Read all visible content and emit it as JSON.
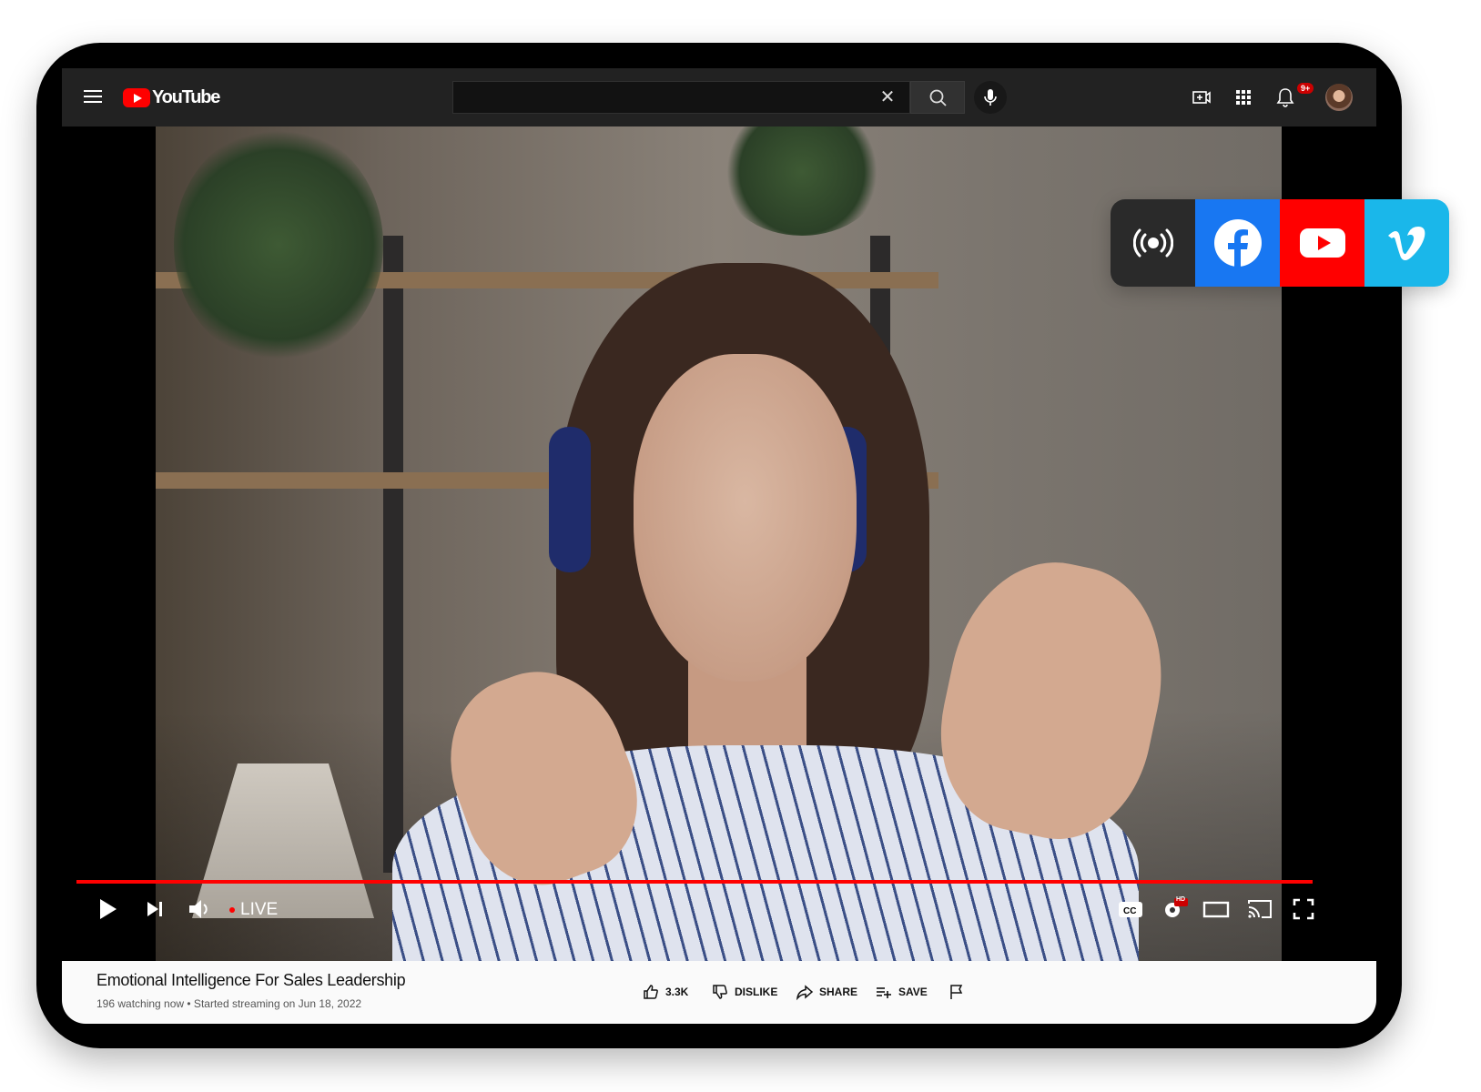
{
  "header": {
    "brand": "YouTube",
    "search_clear": "✕",
    "notification_badge": "9+"
  },
  "player": {
    "live_label": "LIVE",
    "hd_badge": "HD",
    "progress_percent": 100
  },
  "video_info": {
    "title": "Emotional Intelligence For Sales Leadership",
    "meta": "196 watching now • Started streaming on Jun 18, 2022",
    "actions": {
      "like_count": "3.3K",
      "dislike": "DISLIKE",
      "share": "SHARE",
      "save": "SAVE"
    }
  },
  "platforms": [
    {
      "name": "broadcast-icon",
      "color": "#2a2a2a"
    },
    {
      "name": "facebook-icon",
      "color": "#1877f2"
    },
    {
      "name": "youtube-icon",
      "color": "#ff0000"
    },
    {
      "name": "vimeo-icon",
      "color": "#1ab7ea"
    }
  ],
  "icons": {
    "menu": "menu-icon",
    "search": "search-icon",
    "mic": "mic-icon",
    "create": "create-video-icon",
    "apps": "apps-grid-icon",
    "notifications": "bell-icon",
    "play": "play-icon",
    "next": "skip-next-icon",
    "volume": "volume-icon",
    "captions": "captions-icon",
    "settings": "settings-icon",
    "theater": "theater-mode-icon",
    "cast": "cast-icon",
    "fullscreen": "fullscreen-icon",
    "flag": "flag-icon"
  }
}
